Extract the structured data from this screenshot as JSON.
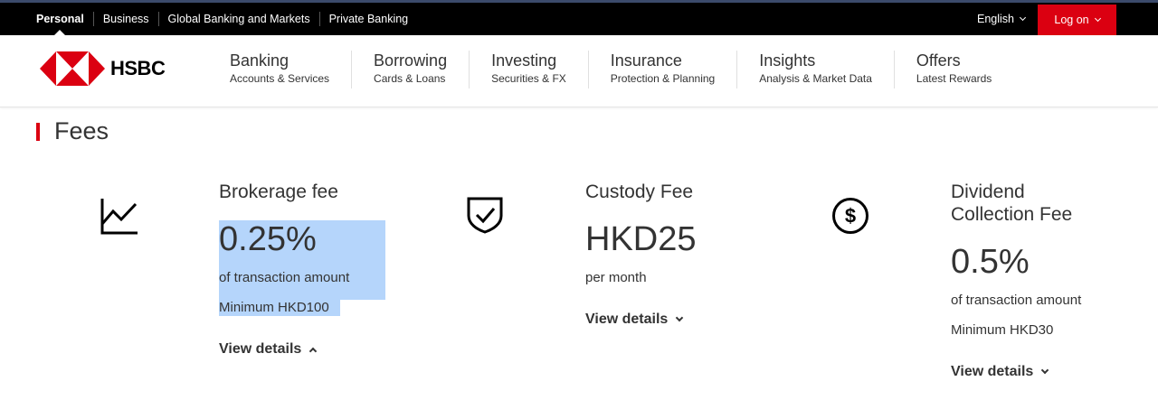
{
  "topbar": {
    "links": [
      "Personal",
      "Business",
      "Global Banking and Markets",
      "Private Banking"
    ],
    "language": "English",
    "logon": "Log on"
  },
  "header": {
    "brand": "HSBC",
    "nav": [
      {
        "title": "Banking",
        "sub": "Accounts & Services"
      },
      {
        "title": "Borrowing",
        "sub": "Cards & Loans"
      },
      {
        "title": "Investing",
        "sub": "Securities & FX"
      },
      {
        "title": "Insurance",
        "sub": "Protection & Planning"
      },
      {
        "title": "Insights",
        "sub": "Analysis & Market Data"
      },
      {
        "title": "Offers",
        "sub": "Latest Rewards"
      }
    ]
  },
  "section": {
    "title": "Fees"
  },
  "fees": [
    {
      "title": "Brokerage fee",
      "value": "0.25%",
      "line1": "of transaction amount",
      "line2": "Minimum HKD100",
      "view": "View details",
      "icon": "chart-line-icon"
    },
    {
      "title": "Custody Fee",
      "value": "HKD25",
      "line1": "per month",
      "view": "View details",
      "icon": "shield-check-icon"
    },
    {
      "title_line1": "Dividend",
      "title_line2": "Collection Fee",
      "value": "0.5%",
      "line1": "of transaction amount",
      "line2": "Minimum HKD30",
      "view": "View details",
      "icon": "dollar-circle-icon"
    }
  ],
  "colors": {
    "brand_red": "#db0011",
    "selection": "#b5d5fb",
    "topbar": "#000000"
  }
}
